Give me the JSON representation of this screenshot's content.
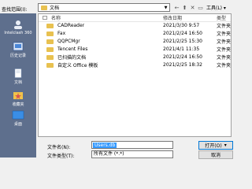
{
  "toolbar": {
    "lookin_label": "查找范围(I):",
    "lookin_value": "文档",
    "tools_label": "工具(L) ▾"
  },
  "places": [
    {
      "label": "Intelclash 360",
      "icon": "user-icon"
    },
    {
      "label": "历史记录",
      "icon": "history-icon"
    },
    {
      "label": "文档",
      "icon": "documents-icon"
    },
    {
      "label": "收藏夹",
      "icon": "favorites-icon"
    },
    {
      "label": "桌面",
      "icon": "desktop-icon"
    }
  ],
  "list": {
    "headers": {
      "name": "名称",
      "date": "修改日期",
      "type": "类型"
    },
    "rows": [
      {
        "name": "CADReader",
        "date": "2021/3/30 9:57",
        "type": "文件夹"
      },
      {
        "name": "Fax",
        "date": "2021/2/24 16:50",
        "type": "文件夹"
      },
      {
        "name": "QQPCMgr",
        "date": "2021/2/25 15:30",
        "type": "文件夹"
      },
      {
        "name": "Tencent Files",
        "date": "2021/4/1 11:35",
        "type": "文件夹"
      },
      {
        "name": "已扫描的文档",
        "date": "2021/2/24 16:50",
        "type": "文件夹"
      },
      {
        "name": "自定义 Office 模板",
        "date": "2021/2/25 18:32",
        "type": "文件夹"
      }
    ]
  },
  "bottom": {
    "filename_label": "文件名(N):",
    "filename_value": "Users.db",
    "filetype_label": "文件类型(T):",
    "filetype_value": "所有文件 (*.*)",
    "open_label": "打开(O)",
    "open_arrow": "▾",
    "cancel_label": "取消"
  },
  "colors": {
    "places_bg": "#5e6f8d",
    "selection": "#3399ff",
    "folder": "#e8c150"
  }
}
